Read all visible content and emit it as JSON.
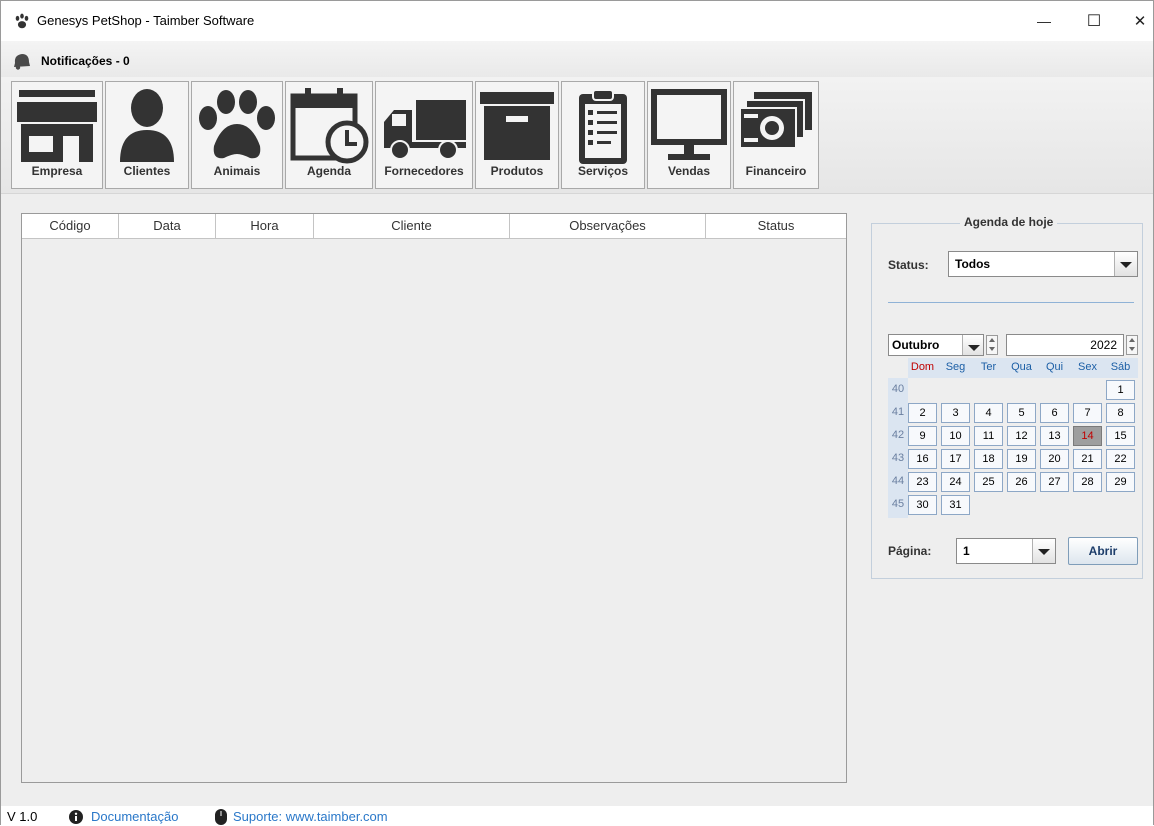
{
  "window": {
    "title": "Genesys PetShop - Taimber Software",
    "min_symbol": "—",
    "max_symbol": "☐",
    "close_symbol": "✕",
    "icon": "paw-icon"
  },
  "notifications": {
    "label": "Notificações - 0",
    "icon": "bell-icon"
  },
  "toolbar": {
    "items": [
      {
        "label": "Empresa",
        "icon": "store-icon"
      },
      {
        "label": "Clientes",
        "icon": "person-icon"
      },
      {
        "label": "Animais",
        "icon": "paw-icon"
      },
      {
        "label": "Agenda",
        "icon": "calendar-clock-icon"
      },
      {
        "label": "Fornecedores",
        "icon": "truck-icon"
      },
      {
        "label": "Produtos",
        "icon": "box-icon"
      },
      {
        "label": "Serviços",
        "icon": "clipboard-icon"
      },
      {
        "label": "Vendas",
        "icon": "monitor-icon"
      },
      {
        "label": "Financeiro",
        "icon": "money-icon"
      }
    ]
  },
  "table": {
    "columns": [
      "Código",
      "Data",
      "Hora",
      "Cliente",
      "Observações",
      "Status"
    ],
    "rows": []
  },
  "agenda": {
    "title": "Agenda de hoje",
    "status_label": "Status:",
    "status_value": "Todos",
    "month": "Outubro",
    "year": "2022",
    "weekdays": [
      "Dom",
      "Seg",
      "Ter",
      "Qua",
      "Qui",
      "Sex",
      "Sáb"
    ],
    "weeks": [
      {
        "num": "40",
        "days": [
          "",
          "",
          "",
          "",
          "",
          "",
          "1"
        ]
      },
      {
        "num": "41",
        "days": [
          "2",
          "3",
          "4",
          "5",
          "6",
          "7",
          "8"
        ]
      },
      {
        "num": "42",
        "days": [
          "9",
          "10",
          "11",
          "12",
          "13",
          "14",
          "15"
        ]
      },
      {
        "num": "43",
        "days": [
          "16",
          "17",
          "18",
          "19",
          "20",
          "21",
          "22"
        ]
      },
      {
        "num": "44",
        "days": [
          "23",
          "24",
          "25",
          "26",
          "27",
          "28",
          "29"
        ]
      },
      {
        "num": "45",
        "days": [
          "30",
          "31",
          "",
          "",
          "",
          "",
          ""
        ]
      }
    ],
    "today": "14",
    "page_label": "Página:",
    "page_value": "1",
    "open_button": "Abrir"
  },
  "statusbar": {
    "version": "V 1.0",
    "doc_link": "Documentação",
    "support_link": "Suporte: www.taimber.com"
  }
}
